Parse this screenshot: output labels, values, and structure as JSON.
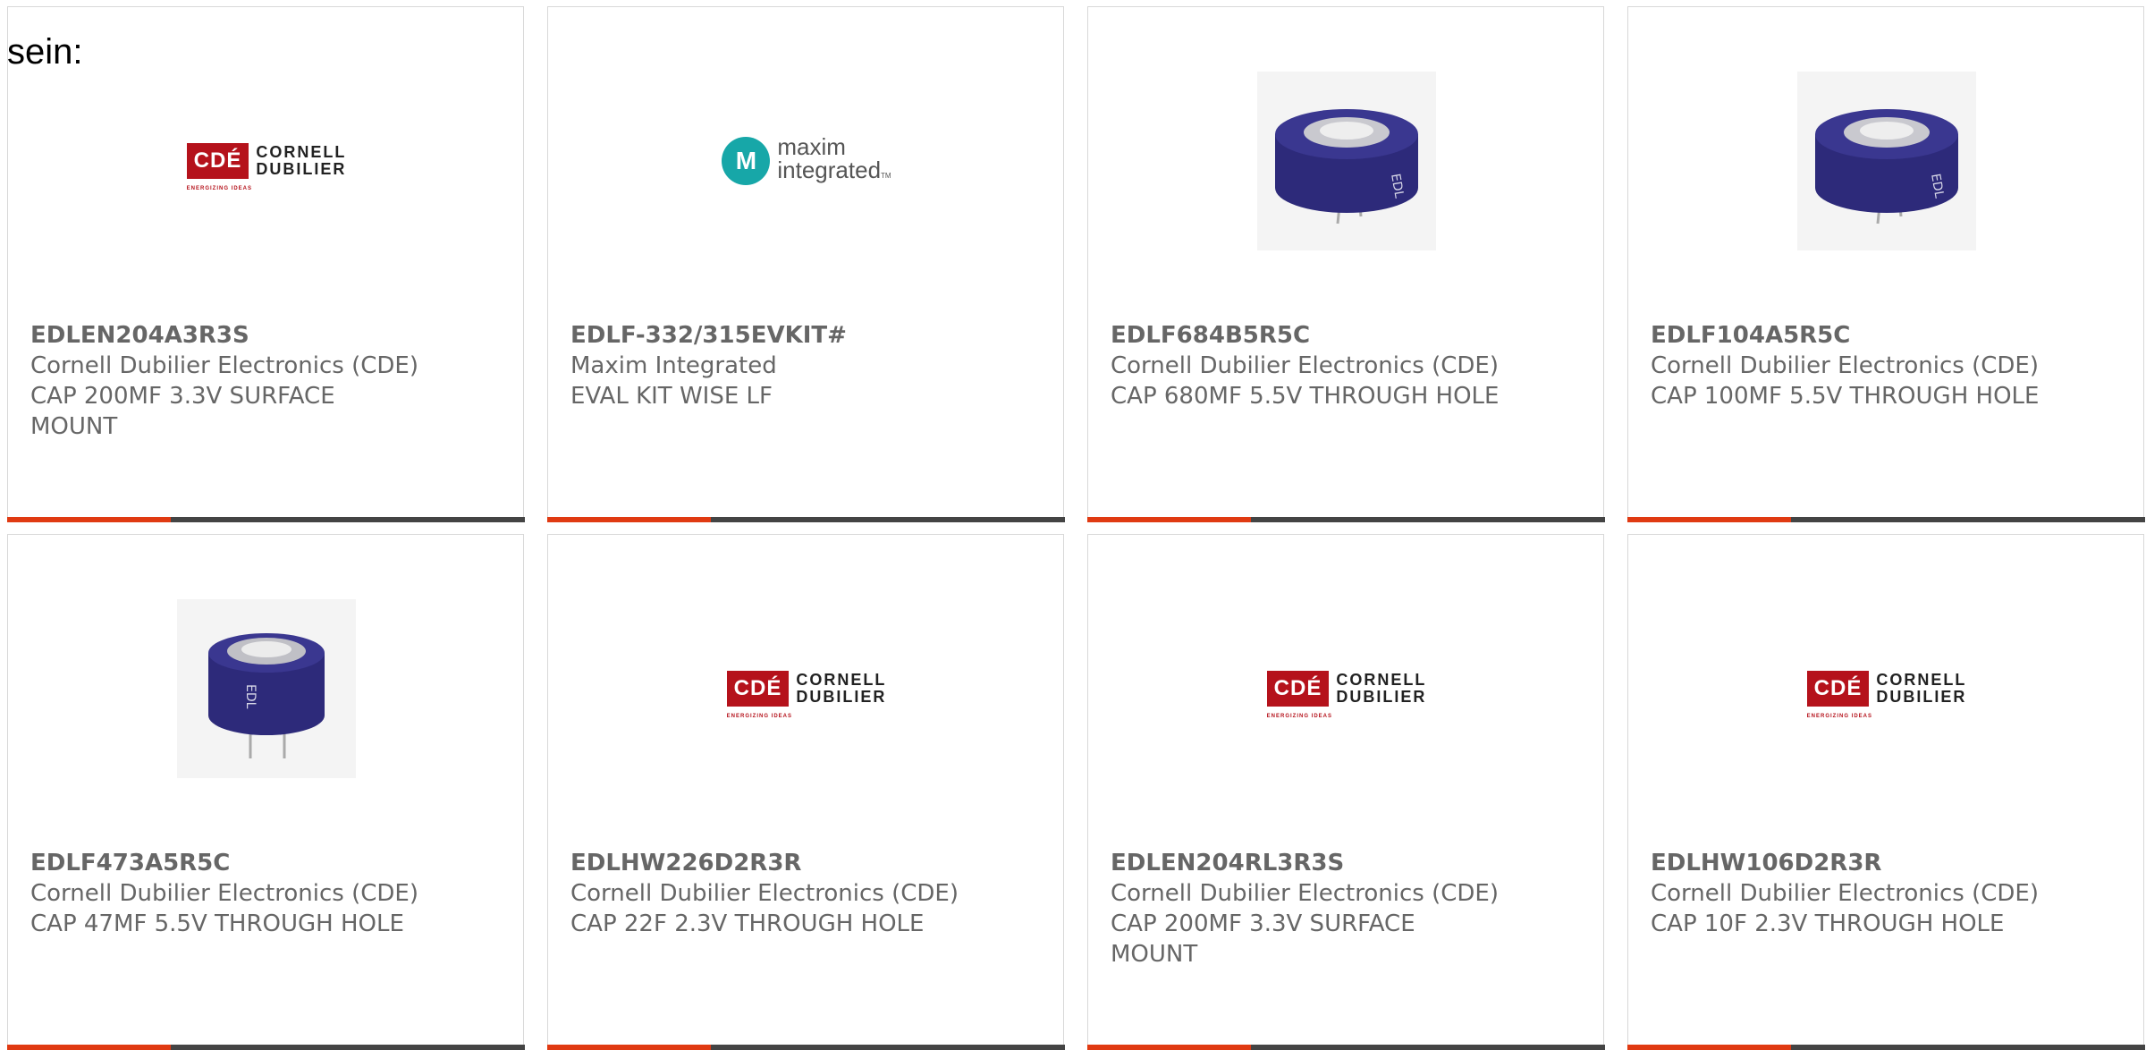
{
  "intro_text": "sein:",
  "logos": {
    "cde_mark": "CDÉ",
    "cde_line1": "CORNELL",
    "cde_line2": "DUBILIER",
    "cde_tagline": "ENERGIZING IDEAS",
    "maxim_mark": "M",
    "maxim_line1": "maxim",
    "maxim_line2": "integrated",
    "maxim_tm": "TM",
    "cap_marking": "EDL"
  },
  "colors": {
    "accent": "#e03a12",
    "bar": "#444444",
    "text": "#666666",
    "border": "#d8d8d8"
  },
  "products": [
    {
      "part_number": "EDLEN204A3R3S",
      "manufacturer": "Cornell Dubilier Electronics (CDE)",
      "description": "CAP 200MF 3.3V SURFACE MOUNT",
      "image": "cde-logo"
    },
    {
      "part_number": "EDLF-332/315EVKIT#",
      "manufacturer": "Maxim Integrated",
      "description": "EVAL KIT WISE LF",
      "image": "maxim-logo"
    },
    {
      "part_number": "EDLF684B5R5C",
      "manufacturer": "Cornell Dubilier Electronics (CDE)",
      "description": "CAP 680MF 5.5V THROUGH HOLE",
      "image": "capacitor-photo"
    },
    {
      "part_number": "EDLF104A5R5C",
      "manufacturer": "Cornell Dubilier Electronics (CDE)",
      "description": "CAP 100MF 5.5V THROUGH HOLE",
      "image": "capacitor-photo"
    },
    {
      "part_number": "EDLF473A5R5C",
      "manufacturer": "Cornell Dubilier Electronics (CDE)",
      "description": "CAP 47MF 5.5V THROUGH HOLE",
      "image": "capacitor-photo"
    },
    {
      "part_number": "EDLHW226D2R3R",
      "manufacturer": "Cornell Dubilier Electronics (CDE)",
      "description": "CAP 22F 2.3V THROUGH HOLE",
      "image": "cde-logo"
    },
    {
      "part_number": "EDLEN204RL3R3S",
      "manufacturer": "Cornell Dubilier Electronics (CDE)",
      "description": "CAP 200MF 3.3V SURFACE MOUNT",
      "image": "cde-logo"
    },
    {
      "part_number": "EDLHW106D2R3R",
      "manufacturer": "Cornell Dubilier Electronics (CDE)",
      "description": "CAP 10F 2.3V THROUGH HOLE",
      "image": "cde-logo"
    }
  ]
}
